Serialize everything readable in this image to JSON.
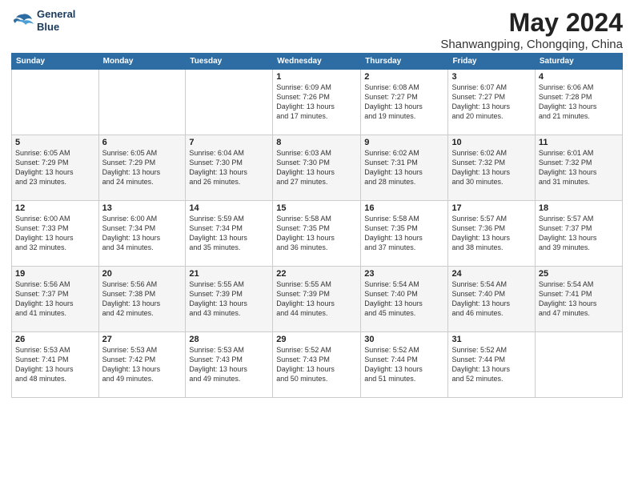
{
  "logo": {
    "line1": "General",
    "line2": "Blue"
  },
  "title": "May 2024",
  "subtitle": "Shanwangping, Chongqing, China",
  "days_of_week": [
    "Sunday",
    "Monday",
    "Tuesday",
    "Wednesday",
    "Thursday",
    "Friday",
    "Saturday"
  ],
  "weeks": [
    [
      {
        "day": "",
        "info": ""
      },
      {
        "day": "",
        "info": ""
      },
      {
        "day": "",
        "info": ""
      },
      {
        "day": "1",
        "info": "Sunrise: 6:09 AM\nSunset: 7:26 PM\nDaylight: 13 hours\nand 17 minutes."
      },
      {
        "day": "2",
        "info": "Sunrise: 6:08 AM\nSunset: 7:27 PM\nDaylight: 13 hours\nand 19 minutes."
      },
      {
        "day": "3",
        "info": "Sunrise: 6:07 AM\nSunset: 7:27 PM\nDaylight: 13 hours\nand 20 minutes."
      },
      {
        "day": "4",
        "info": "Sunrise: 6:06 AM\nSunset: 7:28 PM\nDaylight: 13 hours\nand 21 minutes."
      }
    ],
    [
      {
        "day": "5",
        "info": "Sunrise: 6:05 AM\nSunset: 7:29 PM\nDaylight: 13 hours\nand 23 minutes."
      },
      {
        "day": "6",
        "info": "Sunrise: 6:05 AM\nSunset: 7:29 PM\nDaylight: 13 hours\nand 24 minutes."
      },
      {
        "day": "7",
        "info": "Sunrise: 6:04 AM\nSunset: 7:30 PM\nDaylight: 13 hours\nand 26 minutes."
      },
      {
        "day": "8",
        "info": "Sunrise: 6:03 AM\nSunset: 7:30 PM\nDaylight: 13 hours\nand 27 minutes."
      },
      {
        "day": "9",
        "info": "Sunrise: 6:02 AM\nSunset: 7:31 PM\nDaylight: 13 hours\nand 28 minutes."
      },
      {
        "day": "10",
        "info": "Sunrise: 6:02 AM\nSunset: 7:32 PM\nDaylight: 13 hours\nand 30 minutes."
      },
      {
        "day": "11",
        "info": "Sunrise: 6:01 AM\nSunset: 7:32 PM\nDaylight: 13 hours\nand 31 minutes."
      }
    ],
    [
      {
        "day": "12",
        "info": "Sunrise: 6:00 AM\nSunset: 7:33 PM\nDaylight: 13 hours\nand 32 minutes."
      },
      {
        "day": "13",
        "info": "Sunrise: 6:00 AM\nSunset: 7:34 PM\nDaylight: 13 hours\nand 34 minutes."
      },
      {
        "day": "14",
        "info": "Sunrise: 5:59 AM\nSunset: 7:34 PM\nDaylight: 13 hours\nand 35 minutes."
      },
      {
        "day": "15",
        "info": "Sunrise: 5:58 AM\nSunset: 7:35 PM\nDaylight: 13 hours\nand 36 minutes."
      },
      {
        "day": "16",
        "info": "Sunrise: 5:58 AM\nSunset: 7:35 PM\nDaylight: 13 hours\nand 37 minutes."
      },
      {
        "day": "17",
        "info": "Sunrise: 5:57 AM\nSunset: 7:36 PM\nDaylight: 13 hours\nand 38 minutes."
      },
      {
        "day": "18",
        "info": "Sunrise: 5:57 AM\nSunset: 7:37 PM\nDaylight: 13 hours\nand 39 minutes."
      }
    ],
    [
      {
        "day": "19",
        "info": "Sunrise: 5:56 AM\nSunset: 7:37 PM\nDaylight: 13 hours\nand 41 minutes."
      },
      {
        "day": "20",
        "info": "Sunrise: 5:56 AM\nSunset: 7:38 PM\nDaylight: 13 hours\nand 42 minutes."
      },
      {
        "day": "21",
        "info": "Sunrise: 5:55 AM\nSunset: 7:39 PM\nDaylight: 13 hours\nand 43 minutes."
      },
      {
        "day": "22",
        "info": "Sunrise: 5:55 AM\nSunset: 7:39 PM\nDaylight: 13 hours\nand 44 minutes."
      },
      {
        "day": "23",
        "info": "Sunrise: 5:54 AM\nSunset: 7:40 PM\nDaylight: 13 hours\nand 45 minutes."
      },
      {
        "day": "24",
        "info": "Sunrise: 5:54 AM\nSunset: 7:40 PM\nDaylight: 13 hours\nand 46 minutes."
      },
      {
        "day": "25",
        "info": "Sunrise: 5:54 AM\nSunset: 7:41 PM\nDaylight: 13 hours\nand 47 minutes."
      }
    ],
    [
      {
        "day": "26",
        "info": "Sunrise: 5:53 AM\nSunset: 7:41 PM\nDaylight: 13 hours\nand 48 minutes."
      },
      {
        "day": "27",
        "info": "Sunrise: 5:53 AM\nSunset: 7:42 PM\nDaylight: 13 hours\nand 49 minutes."
      },
      {
        "day": "28",
        "info": "Sunrise: 5:53 AM\nSunset: 7:43 PM\nDaylight: 13 hours\nand 49 minutes."
      },
      {
        "day": "29",
        "info": "Sunrise: 5:52 AM\nSunset: 7:43 PM\nDaylight: 13 hours\nand 50 minutes."
      },
      {
        "day": "30",
        "info": "Sunrise: 5:52 AM\nSunset: 7:44 PM\nDaylight: 13 hours\nand 51 minutes."
      },
      {
        "day": "31",
        "info": "Sunrise: 5:52 AM\nSunset: 7:44 PM\nDaylight: 13 hours\nand 52 minutes."
      },
      {
        "day": "",
        "info": ""
      }
    ]
  ]
}
